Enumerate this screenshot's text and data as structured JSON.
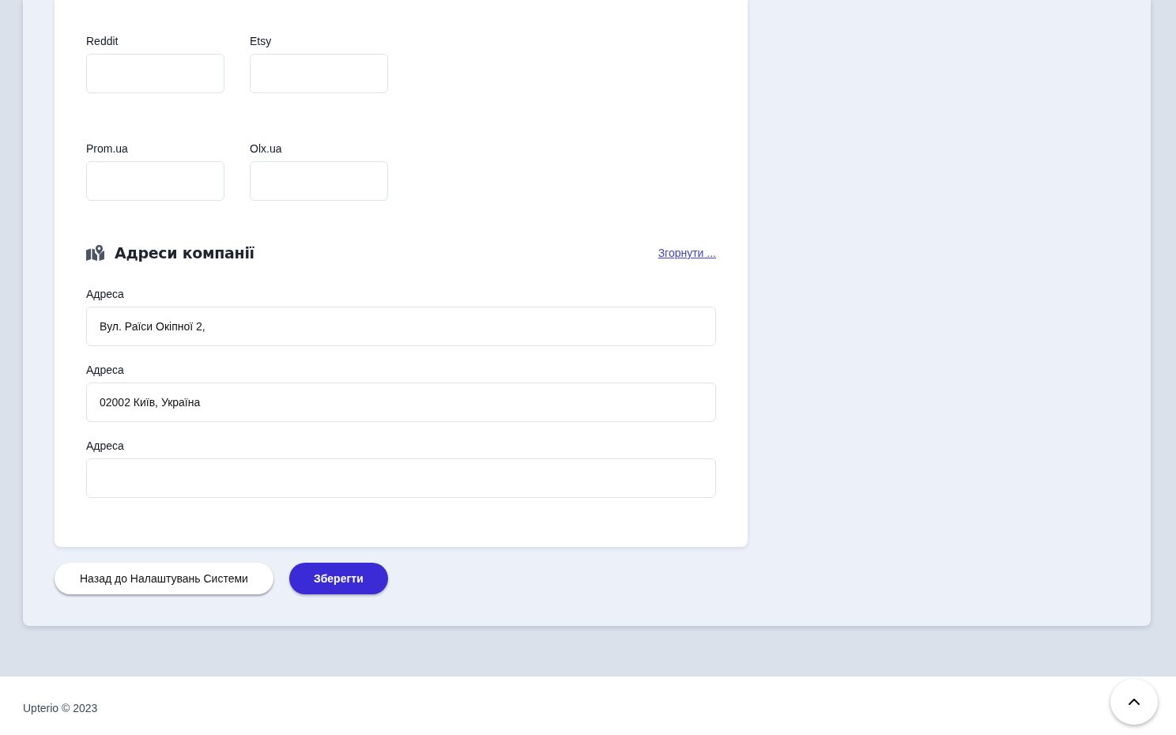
{
  "marketplace_fields": [
    {
      "label": "Reddit"
    },
    {
      "label": "Etsy"
    },
    {
      "label": "Prom.ua"
    },
    {
      "label": "Olx.ua"
    }
  ],
  "addresses_section": {
    "title": "Адреси компанії",
    "collapse_link": "Згорнути ...",
    "fields": [
      {
        "label": "Адреса",
        "value": "Вул. Раїси Окіпної 2,"
      },
      {
        "label": "Адреса",
        "value": "02002 Київ, Україна"
      },
      {
        "label": "Адреса"
      }
    ]
  },
  "buttons": [
    {
      "label": "Назад до Налаштувань Системи",
      "kind": "secondary"
    },
    {
      "label": "Зберегти",
      "kind": "primary"
    }
  ],
  "footer": {
    "copyright": "Upterio © 2023"
  }
}
